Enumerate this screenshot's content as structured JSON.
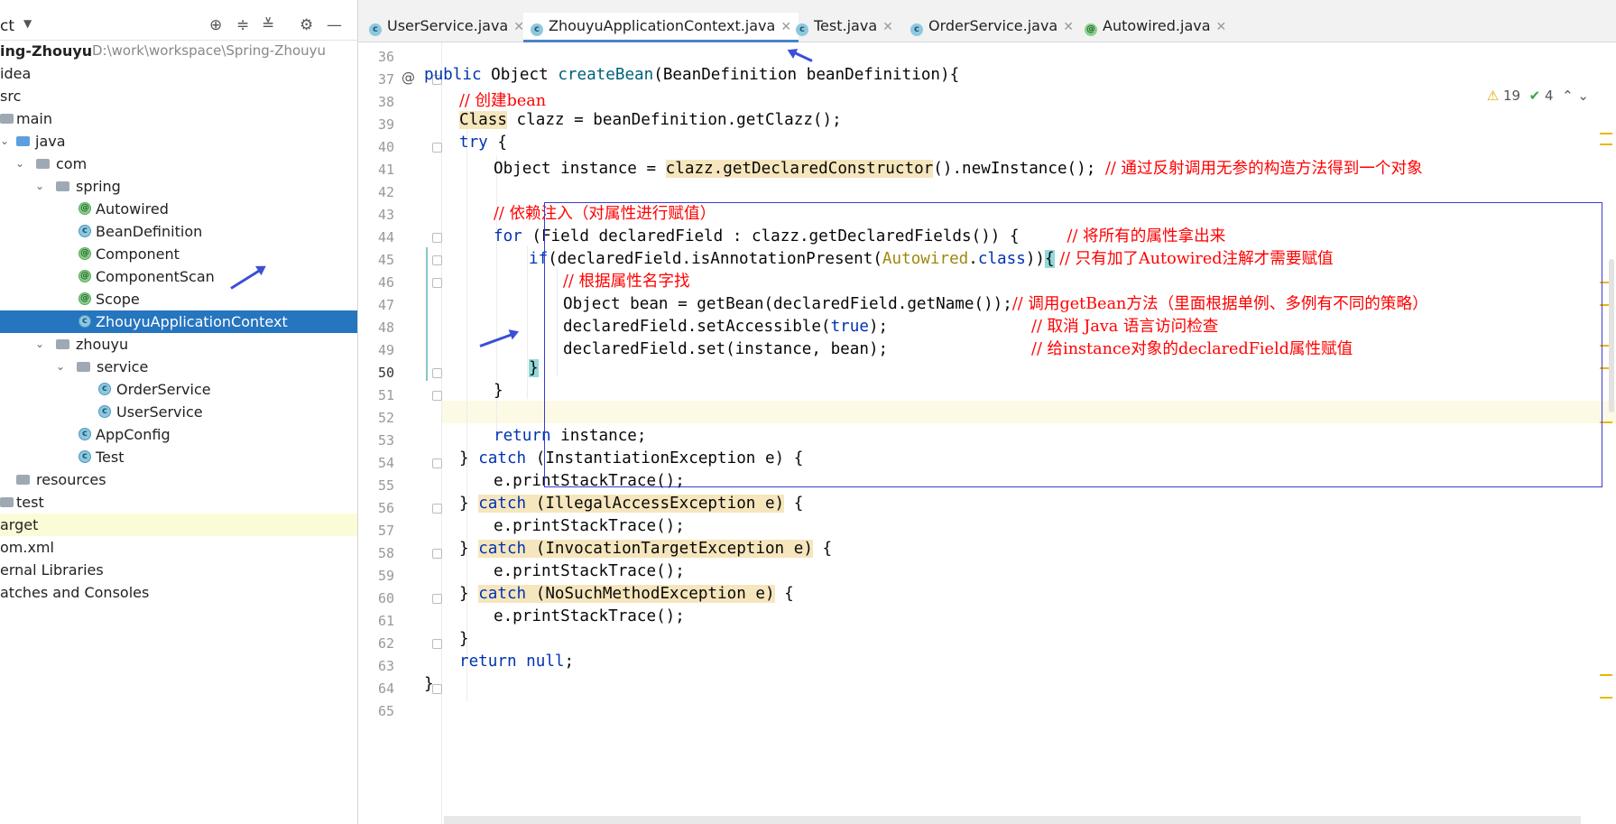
{
  "colors": {
    "selection": "#2675bf",
    "keyword": "#0033b3",
    "comment": "#ff0000",
    "annotation_box": "#3a3ad6"
  },
  "project": {
    "toolbar_title": "ct",
    "toolbar_icons": [
      "locate-icon",
      "expand-all-icon",
      "collapse-all-icon",
      "settings-icon",
      "minimize-icon"
    ],
    "root_name": "ing-Zhouyu",
    "root_path": "D:\\work\\workspace\\Spring-Zhouyu",
    "items": [
      {
        "label": "idea",
        "icon": "none"
      },
      {
        "label": "src",
        "icon": "none"
      },
      {
        "label": "main",
        "icon": "folder"
      },
      {
        "label": "java",
        "icon": "folder-blue"
      },
      {
        "label": "com",
        "icon": "folder"
      },
      {
        "label": "spring",
        "icon": "folder"
      },
      {
        "label": "Autowired",
        "icon": "annotation"
      },
      {
        "label": "BeanDefinition",
        "icon": "class"
      },
      {
        "label": "Component",
        "icon": "annotation"
      },
      {
        "label": "ComponentScan",
        "icon": "annotation"
      },
      {
        "label": "Scope",
        "icon": "annotation"
      },
      {
        "label": "ZhouyuApplicationContext",
        "icon": "class"
      },
      {
        "label": "zhouyu",
        "icon": "folder"
      },
      {
        "label": "service",
        "icon": "folder"
      },
      {
        "label": "OrderService",
        "icon": "class"
      },
      {
        "label": "UserService",
        "icon": "class"
      },
      {
        "label": "AppConfig",
        "icon": "class"
      },
      {
        "label": "Test",
        "icon": "class"
      },
      {
        "label": "resources",
        "icon": "folder"
      },
      {
        "label": "test",
        "icon": "folder"
      },
      {
        "label": "arget",
        "icon": "none"
      },
      {
        "label": "om.xml",
        "icon": "none"
      },
      {
        "label": "ernal Libraries",
        "icon": "none"
      },
      {
        "label": "atches and Consoles",
        "icon": "none"
      }
    ]
  },
  "tabs": [
    {
      "label": "UserService.java",
      "icon": "class",
      "active": false
    },
    {
      "label": "ZhouyuApplicationContext.java",
      "icon": "class",
      "active": true
    },
    {
      "label": "Test.java",
      "icon": "class",
      "active": false
    },
    {
      "label": "OrderService.java",
      "icon": "class",
      "active": false
    },
    {
      "label": "Autowired.java",
      "icon": "annotation",
      "active": false
    }
  ],
  "inspections": {
    "warnings": "19",
    "ok": "4"
  },
  "editor": {
    "line_numbers": [
      "36",
      "37",
      "38",
      "39",
      "40",
      "41",
      "42",
      "43",
      "44",
      "45",
      "46",
      "47",
      "48",
      "49",
      "50",
      "51",
      "52",
      "53",
      "54",
      "55",
      "56",
      "57",
      "58",
      "59",
      "60",
      "61",
      "62",
      "63",
      "64",
      "65"
    ],
    "current_line": "50",
    "code": {
      "l37": {
        "a": "public",
        "b": "Object",
        "c": "createBean",
        "d": "(BeanDefinition beanDefinition){"
      },
      "l38": "// 创建bean",
      "l39": {
        "a": "Class",
        "b": " clazz = beanDefinition.getClazz();"
      },
      "l40": {
        "a": "try",
        "b": " {"
      },
      "l41": {
        "a": "Object instance = ",
        "b": "clazz.getDeclaredConstructor",
        "c": "().newInstance(); ",
        "d": "// 通过反射调用无参的构造方法得到一个对象"
      },
      "l43": "// 依赖注入（对属性进行赋值）",
      "l44": {
        "a": "for",
        "b": " (Field declaredField : clazz.getDeclaredFields()) {     ",
        "c": "// 将所有的属性拿出来"
      },
      "l45": {
        "a": "if",
        "b": "(declaredField.isAnnotationPresent(",
        "c": "Autowired",
        "d": ".",
        "e": "class",
        "f": "))",
        "g": "{",
        "h": " // 只有加了Autowired注解才需要赋值"
      },
      "l46": "// 根据属性名字找",
      "l47": {
        "a": "Object bean = getBean(declaredField.getName());",
        "b": "// 调用getBean方法（里面根据单例、多例有不同的策略）"
      },
      "l48": {
        "a": "declaredField.setAccessible(",
        "b": "true",
        "c": ");               ",
        "d": "// 取消 Java 语言访问检查"
      },
      "l49": {
        "a": "declaredField.set(instance, bean);               ",
        "b": "// 给instance对象的declaredField属性赋值"
      },
      "l50": "}",
      "l51": "}",
      "l53": {
        "a": "return",
        "b": " instance;"
      },
      "l54": {
        "a": "} ",
        "b": "catch",
        "c": " (InstantiationException e) {"
      },
      "l55": "e.printStackTrace();",
      "l56": {
        "a": "} ",
        "b": "catch",
        "c": " (IllegalAccessException e)",
        "d": " {"
      },
      "l57": "e.printStackTrace();",
      "l58": {
        "a": "} ",
        "b": "catch",
        "c": " (InvocationTargetException e)",
        "d": " {"
      },
      "l59": "e.printStackTrace();",
      "l60": {
        "a": "} ",
        "b": "catch",
        "c": " (NoSuchMethodException e)",
        "d": " {"
      },
      "l61": "e.printStackTrace();",
      "l62": "}",
      "l63": {
        "a": "return",
        "b": " null",
        "c": ";"
      },
      "l64": "}"
    }
  }
}
